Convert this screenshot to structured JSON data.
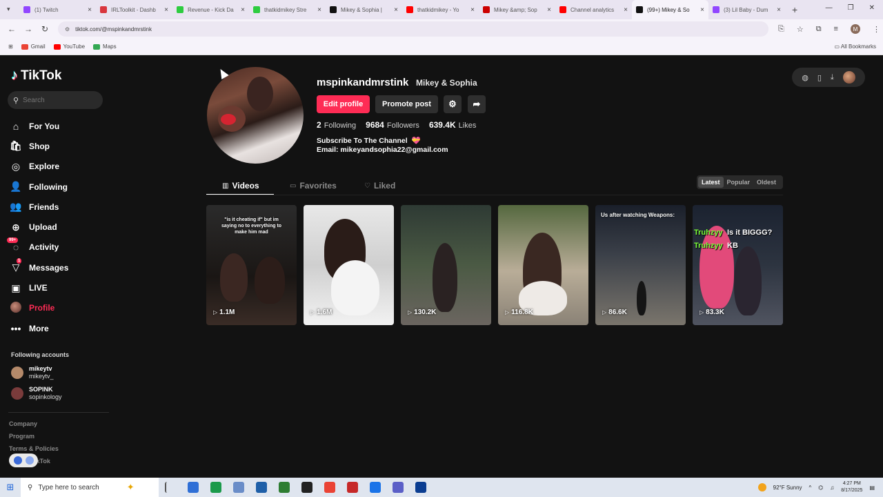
{
  "browser": {
    "tabs": [
      {
        "title": "(1) Twitch",
        "color": "#9146ff"
      },
      {
        "title": "IRLToolkit - Dashb",
        "color": "#d9363e"
      },
      {
        "title": "Revenue - Kick Da",
        "color": "#2ecc40"
      },
      {
        "title": "thatkidmikey Stre",
        "color": "#2ecc40"
      },
      {
        "title": "Mikey & Sophia |",
        "color": "#111111"
      },
      {
        "title": "thatkidmikey - Yo",
        "color": "#ff0000"
      },
      {
        "title": "Mikey &amp; Sop",
        "color": "#cc0000"
      },
      {
        "title": "Channel analytics",
        "color": "#ff0000"
      },
      {
        "title": "(99+) Mikey & So",
        "color": "#111111"
      },
      {
        "title": "(3) Lil Baby - Dum",
        "color": "#9146ff"
      }
    ],
    "active_tab": 8,
    "url": "tiktok.com/@mspinkandmrstink",
    "bookmarks": [
      {
        "label": "Gmail",
        "color": "#ea4335"
      },
      {
        "label": "YouTube",
        "color": "#ff0000"
      },
      {
        "label": "Maps",
        "color": "#34a853"
      }
    ],
    "all_bookmarks": "All Bookmarks",
    "profile_initial": "M"
  },
  "sidebar": {
    "logo": "TikTok",
    "search_placeholder": "Search",
    "menu": [
      {
        "label": "For You",
        "icon": "⌂",
        "name": "for-you"
      },
      {
        "label": "Shop",
        "icon": "🛍",
        "name": "shop"
      },
      {
        "label": "Explore",
        "icon": "◎",
        "name": "explore"
      },
      {
        "label": "Following",
        "icon": "👤",
        "name": "following"
      },
      {
        "label": "Friends",
        "icon": "👥",
        "name": "friends"
      },
      {
        "label": "Upload",
        "icon": "⊕",
        "name": "upload"
      },
      {
        "label": "Activity",
        "icon": "",
        "name": "activity",
        "badge": "99+"
      },
      {
        "label": "Messages",
        "icon": "▽",
        "name": "messages",
        "badge": "1"
      },
      {
        "label": "LIVE",
        "icon": "▣",
        "name": "live"
      },
      {
        "label": "Profile",
        "icon": "",
        "name": "profile"
      },
      {
        "label": "More",
        "icon": "•••",
        "name": "more"
      }
    ],
    "active": "profile",
    "following_heading": "Following accounts",
    "accounts": [
      {
        "name": "mikeytv",
        "handle": "mikeytv_",
        "color": "#b58a6a"
      },
      {
        "name": "SOPINK",
        "handle": "sopinkology",
        "color": "#7a3b3b"
      }
    ],
    "footer": [
      "Company",
      "Program",
      "Terms & Policies",
      "© 2025 TikTok"
    ]
  },
  "profile": {
    "username": "mspinkandmrstink",
    "nickname": "Mikey & Sophia",
    "edit_label": "Edit profile",
    "promote_label": "Promote post",
    "stats": [
      {
        "value": "2",
        "label": "Following"
      },
      {
        "value": "9684",
        "label": "Followers"
      },
      {
        "value": "639.4K",
        "label": "Likes"
      }
    ],
    "bio_line1": "Subscribe To The Channel",
    "bio_emoji": "💝",
    "bio_line2": "Email: mikeyandsophia22@gmail.com"
  },
  "tabs": {
    "items": [
      {
        "label": "Videos",
        "icon": "▥"
      },
      {
        "label": "Favorites",
        "icon": "▭"
      },
      {
        "label": "Liked",
        "icon": "♡"
      }
    ],
    "active": 0,
    "sort": [
      "Latest",
      "Popular",
      "Oldest"
    ],
    "sort_active": 0
  },
  "videos": [
    {
      "views": "1.1M",
      "caption": "\"is it cheating if\" but im saying no to everything to make him mad",
      "bg": "linear-gradient(#2b2b2b,#1a1614 60%,#3a2c26)"
    },
    {
      "views": "1.6M",
      "caption": "",
      "bg": "linear-gradient(#e8e8e8,#cfcfcf 50%,#f2f2f2)"
    },
    {
      "views": "130.2K",
      "caption": "",
      "bg": "linear-gradient(#2e3a34,#4b5a44 50%,#6b6560)"
    },
    {
      "views": "116.8K",
      "caption": "",
      "bg": "linear-gradient(#55683f,#b9ad98 55%,#8a8276)"
    },
    {
      "views": "86.6K",
      "caption": "Us after watching Weapons:",
      "bg": "linear-gradient(#1a1f2a,#3a3f48 40%,#7a756c)"
    },
    {
      "views": "83.3K",
      "caption": "",
      "bg": "linear-gradient(#1b2230,#2d3440 50%,#505460)"
    }
  ],
  "video5_overlay": {
    "green1": "Truhzyy",
    "white1": "Is it BIGGG?",
    "green2": "Truhzyy",
    "white2": "KB"
  },
  "taskbar": {
    "search_placeholder": "Type here to search",
    "weather": "92°F  Sunny",
    "time": "4:27 PM",
    "date": "8/17/2025"
  }
}
